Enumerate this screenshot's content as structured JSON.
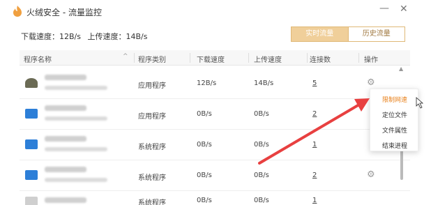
{
  "window": {
    "title": "火绒安全 - 流量监控",
    "minimize": "—",
    "close": "✕"
  },
  "speed": {
    "download": "下载速度：12B/s",
    "upload": "上传速度：14B/s"
  },
  "tabs": {
    "realtime": "实时流量",
    "history": "历史流量"
  },
  "table": {
    "headers": [
      "程序名称",
      "程序类别",
      "下载速度",
      "上传速度",
      "连接数",
      "操作"
    ],
    "rows": [
      {
        "category": "应用程序",
        "down": "12B/s",
        "up": "14B/s",
        "conn": "5"
      },
      {
        "category": "应用程序",
        "down": "0B/s",
        "up": "0B/s",
        "conn": "2"
      },
      {
        "category": "系统程序",
        "down": "0B/s",
        "up": "0B/s",
        "conn": "1"
      },
      {
        "category": "系统程序",
        "down": "0B/s",
        "up": "0B/s",
        "conn": "2"
      },
      {
        "category": "系统程序",
        "down": "0B/s",
        "up": "0B/s",
        "conn": "1"
      }
    ]
  },
  "context_menu": {
    "items": [
      "限制网速",
      "定位文件",
      "文件属性",
      "结束进程"
    ]
  },
  "icons": {
    "logo": "huorong-flame-icon",
    "gear": "gear-icon",
    "sort": "chevron-up-icon"
  },
  "colors": {
    "accent": "#e8801a",
    "tab_active": "#f0cf9a",
    "arrow": "#e84040"
  }
}
